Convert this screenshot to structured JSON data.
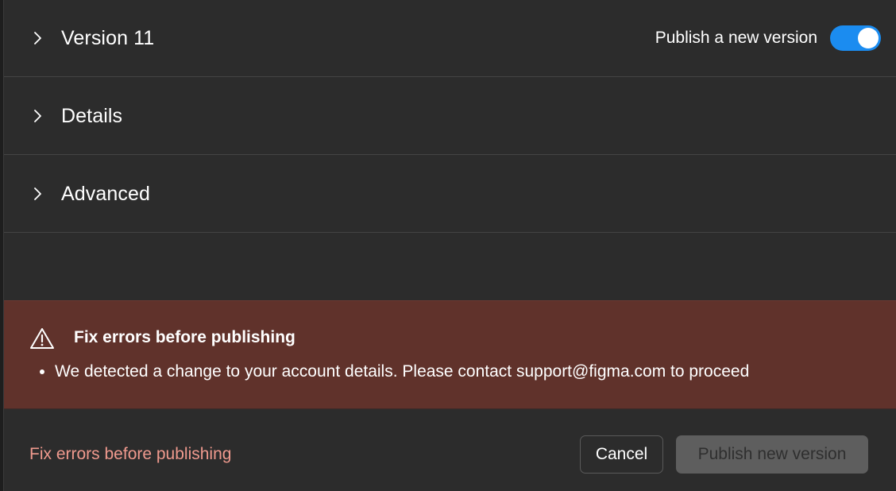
{
  "sections": {
    "version": {
      "title": "Version 11",
      "toggle_label": "Publish a new version",
      "toggle_state": "on"
    },
    "details": {
      "title": "Details"
    },
    "advanced": {
      "title": "Advanced"
    }
  },
  "error_panel": {
    "title": "Fix errors before publishing",
    "items": [
      "We detected a change to your account details. Please contact support@figma.com to proceed"
    ],
    "icon": "warning-triangle-icon"
  },
  "footer": {
    "warning_text": "Fix errors before publishing",
    "cancel_label": "Cancel",
    "publish_label": "Publish new version"
  },
  "colors": {
    "background": "#2c2c2c",
    "toggle_accent": "#1b8cf0",
    "error_background": "#60322b",
    "footer_warning": "#f09a8e",
    "disabled_button": "#5e5e5e"
  }
}
